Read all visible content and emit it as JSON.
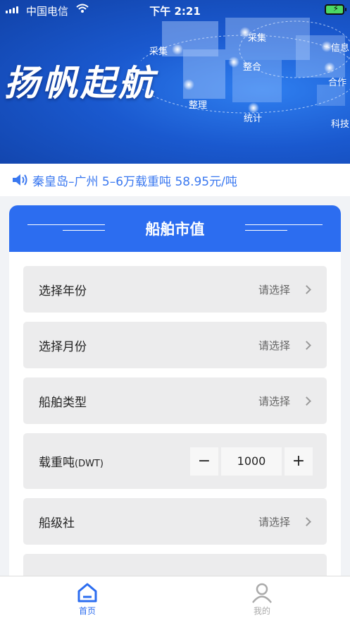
{
  "status_bar": {
    "carrier": "中国电信",
    "time": "下午 2:21"
  },
  "banner": {
    "title": "扬帆起航",
    "tags": [
      "采集",
      "采集",
      "整合",
      "信息",
      "合作",
      "整理",
      "统计",
      "科技"
    ]
  },
  "notice": {
    "text": "秦皇岛–广州 5–6万载重吨 58.95元/吨"
  },
  "card": {
    "title": "船舶市值",
    "rows": [
      {
        "label": "选择年份",
        "value": "请选择"
      },
      {
        "label": "选择月份",
        "value": "请选择"
      },
      {
        "label": "船舶类型",
        "value": "请选择"
      },
      {
        "label": "载重吨",
        "unit": "(DWT)",
        "minus": "−",
        "value": "1000",
        "plus": "+"
      },
      {
        "label": "船级社",
        "value": "请选择"
      }
    ]
  },
  "tabbar": {
    "items": [
      {
        "label": "首页",
        "active": true
      },
      {
        "label": "我的",
        "active": false
      }
    ],
    "active_color": "#2c6df0",
    "inactive_color": "#aaaaaa"
  },
  "colors": {
    "accent": "#2c6df0",
    "notice_text": "#3a78f0"
  }
}
